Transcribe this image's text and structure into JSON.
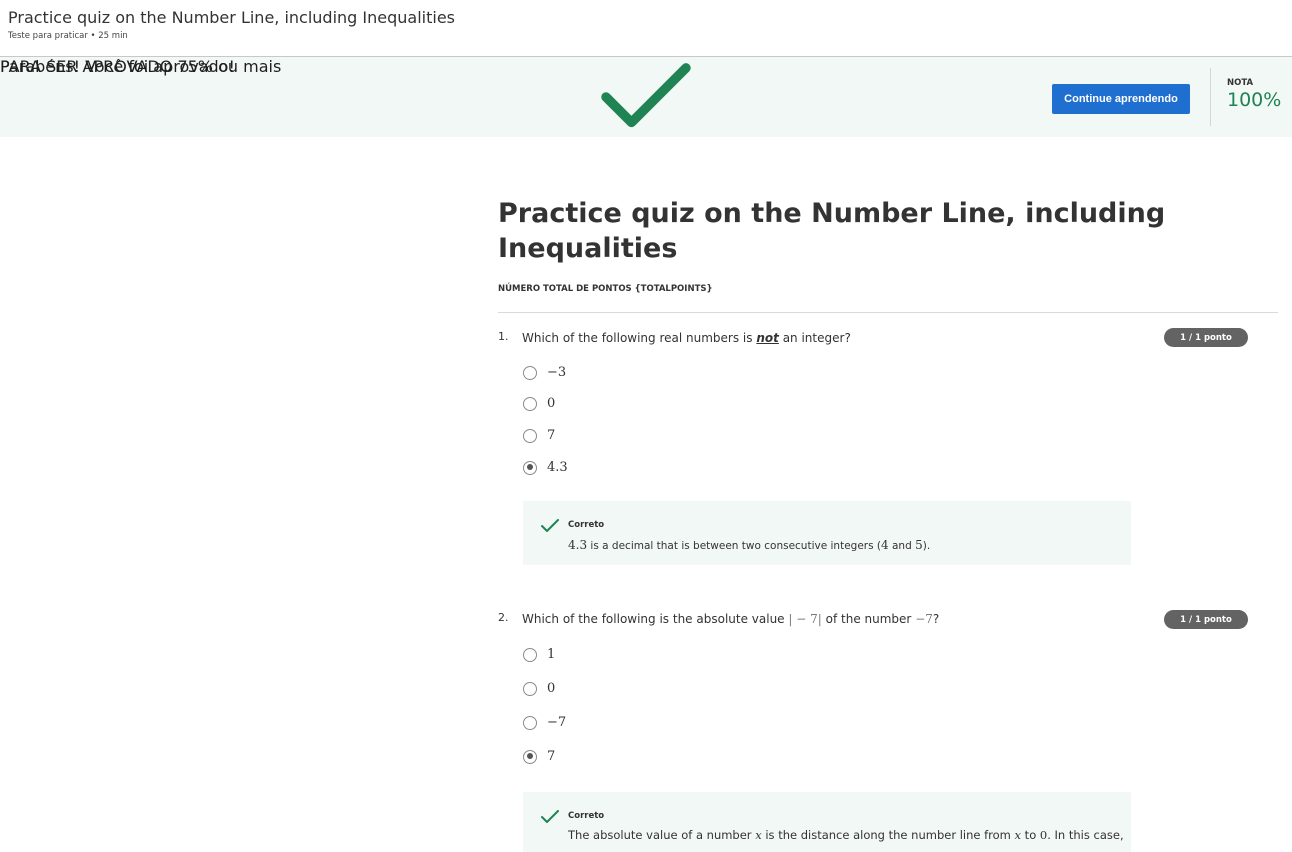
{
  "header": {
    "title": "Practice quiz on the Number Line, including Inequalities",
    "subtitle": "Teste para praticar • 25 min"
  },
  "banner": {
    "title": "Parabéns! Você foi aprovado!",
    "requirement_label": "PARA SER APROVADO",
    "requirement_value": "75% ou mais",
    "continue_label": "Continue aprendendo",
    "grade_label": "NOTA",
    "grade_value": "100%",
    "success_color": "#1f8354",
    "button_color": "#1f6fd1"
  },
  "quiz": {
    "title": "Practice quiz on the Number Line, including Inequalities",
    "total_points": "NÚMERO TOTAL DE PONTOS {TOTALPOINTS}"
  },
  "questions": [
    {
      "number": "1.",
      "text_before": "Which of the following real numbers is",
      "text_emphasis": "not",
      "text_after": "an integer?",
      "points": "1 / 1 ponto",
      "options": [
        {
          "label": "−3",
          "selected": false
        },
        {
          "label": "0",
          "selected": false
        },
        {
          "label": "7",
          "selected": false
        },
        {
          "label": "4.3",
          "selected": true
        }
      ],
      "feedback": {
        "label": "Correto",
        "math_1": "4.3",
        "text_1": " is a decimal that is between two consecutive integers (",
        "math_2": "4",
        "text_2": " and ",
        "math_3": "5",
        "text_3": ")."
      }
    },
    {
      "number": "2.",
      "text_before": "Which of the following is the absolute value",
      "math_1": "| − 7|",
      "text_middle": "of the number",
      "math_2": "−7",
      "text_after": "?",
      "points": "1 / 1 ponto",
      "options": [
        {
          "label": "1",
          "selected": false
        },
        {
          "label": "0",
          "selected": false
        },
        {
          "label": "−7",
          "selected": false
        },
        {
          "label": "7",
          "selected": true
        }
      ],
      "feedback": {
        "label": "Correto",
        "text_1": "The absolute value of a number ",
        "math_1": "x",
        "text_2": " is the distance along the number line from ",
        "math_2": "x",
        "text_3": " to ",
        "math_3": "0",
        "text_4": ". In this case,"
      }
    }
  ],
  "icons": {
    "pass": "check-icon",
    "feedback": "check-icon",
    "radio": "radio-icon"
  }
}
